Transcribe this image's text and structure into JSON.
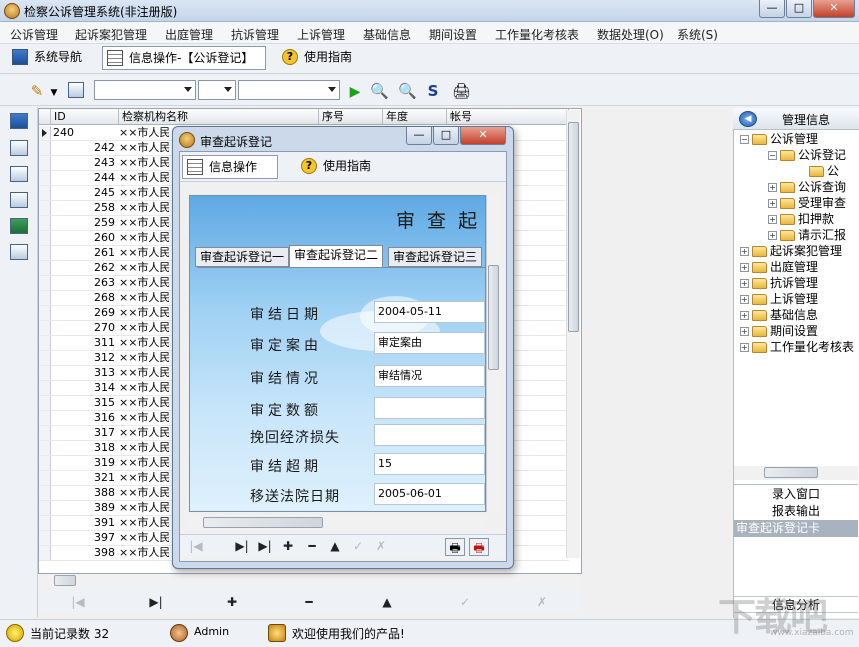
{
  "window": {
    "title": "检察公诉管理系统(非注册版)",
    "min": "—",
    "max": "□",
    "close": "✕"
  },
  "menu": [
    "公诉管理",
    "起诉案犯管理",
    "出庭管理",
    "抗诉管理",
    "上诉管理",
    "基础信息",
    "期间设置",
    "工作量化考核表",
    "数据处理(O)",
    "系统(S)"
  ],
  "tabs": {
    "nav": "系统导航",
    "info": "信息操作-【公诉登记】",
    "guide": "使用指南"
  },
  "grid": {
    "headers": [
      "ID",
      "检察机构名称",
      "序号",
      "年度",
      "帐号"
    ],
    "rows": [
      {
        "id": "240",
        "name": "××市人民"
      },
      {
        "id": "242",
        "name": "××市人民"
      },
      {
        "id": "243",
        "name": "××市人民"
      },
      {
        "id": "244",
        "name": "××市人民"
      },
      {
        "id": "245",
        "name": "××市人民"
      },
      {
        "id": "258",
        "name": "××市人民"
      },
      {
        "id": "259",
        "name": "××市人民"
      },
      {
        "id": "260",
        "name": "××市人民"
      },
      {
        "id": "261",
        "name": "××市人民"
      },
      {
        "id": "262",
        "name": "××市人民"
      },
      {
        "id": "263",
        "name": "××市人民"
      },
      {
        "id": "268",
        "name": "××市人民"
      },
      {
        "id": "269",
        "name": "××市人民"
      },
      {
        "id": "270",
        "name": "××市人民"
      },
      {
        "id": "311",
        "name": "××市人民"
      },
      {
        "id": "312",
        "name": "××市人民"
      },
      {
        "id": "313",
        "name": "××市人民"
      },
      {
        "id": "314",
        "name": "××市人民"
      },
      {
        "id": "315",
        "name": "××市人民"
      },
      {
        "id": "316",
        "name": "××市人民"
      },
      {
        "id": "317",
        "name": "××市人民"
      },
      {
        "id": "318",
        "name": "××市人民"
      },
      {
        "id": "319",
        "name": "××市人民"
      },
      {
        "id": "321",
        "name": "××市人民"
      },
      {
        "id": "388",
        "name": "××市人民"
      },
      {
        "id": "389",
        "name": "××市人民"
      },
      {
        "id": "391",
        "name": "××市人民"
      },
      {
        "id": "397",
        "name": "××市人民"
      },
      {
        "id": "398",
        "name": "××市人民"
      }
    ]
  },
  "nav": {
    "first": "|◀",
    "next": "▶|",
    "add": "✚",
    "delete": "━",
    "up": "▲",
    "post": "✓",
    "cancel": "✗"
  },
  "right_panel": {
    "title": "管理信息",
    "tree": [
      {
        "label": "公诉管理",
        "pm": "−"
      },
      {
        "label": "公诉登记",
        "pm": "−"
      },
      {
        "label": "公",
        "pm": ""
      },
      {
        "label": "公诉查询",
        "pm": "+"
      },
      {
        "label": "受理审查",
        "pm": "+"
      },
      {
        "label": "扣押款",
        "pm": "+"
      },
      {
        "label": "请示汇报",
        "pm": "+"
      },
      {
        "label": "起诉案犯管理",
        "pm": "+"
      },
      {
        "label": "出庭管理",
        "pm": "+"
      },
      {
        "label": "抗诉管理",
        "pm": "+"
      },
      {
        "label": "上诉管理",
        "pm": "+"
      },
      {
        "label": "基础信息",
        "pm": "+"
      },
      {
        "label": "期间设置",
        "pm": "+"
      },
      {
        "label": "工作量化考核表",
        "pm": "+"
      }
    ],
    "links": [
      "录入窗口",
      "报表输出",
      "审查起诉登记卡"
    ],
    "bottom": "信息分析"
  },
  "status": {
    "record_count": "当前记录数 32",
    "user": "Admin",
    "welcome": "欢迎使用我们的产品!"
  },
  "dialog": {
    "title": "审查起诉登记",
    "tab_info": "信息操作",
    "tab_guide": "使用指南",
    "banner": "审 查 起",
    "inner_tabs": [
      "审查起诉登记一",
      "审查起诉登记二",
      "审查起诉登记三"
    ],
    "fields": [
      {
        "label": "审结日期",
        "value": "2004-05-11"
      },
      {
        "label": "审定案由",
        "value": "审定案由"
      },
      {
        "label": "审结情况",
        "value": "审结情况"
      },
      {
        "label": "审定数额",
        "value": ""
      },
      {
        "label": "挽回经济损失",
        "value": ""
      },
      {
        "label": "审结超期",
        "value": "15"
      },
      {
        "label": "移送法院日期",
        "value": "2005-06-01"
      }
    ]
  },
  "watermark": {
    "main": "下载吧",
    "sub": "www.xiazaiba.com"
  }
}
